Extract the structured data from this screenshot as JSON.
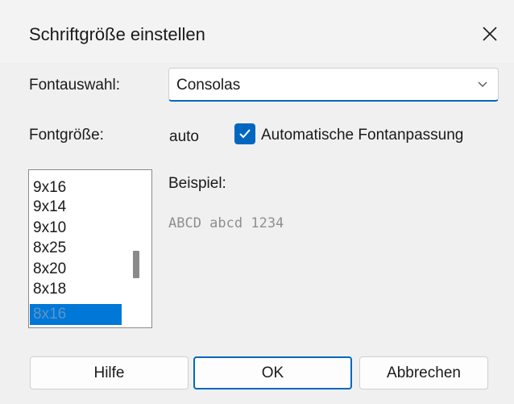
{
  "dialog": {
    "title": "Schriftgröße einstellen"
  },
  "font_select": {
    "label": "Fontauswahl:",
    "value": "Consolas"
  },
  "font_size": {
    "label": "Fontgröße:",
    "value": "auto",
    "auto_fit_label": "Automatische Fontanpassung",
    "auto_fit_checked": true
  },
  "size_list": {
    "items": [
      "9x16",
      "9x14",
      "9x10",
      "8x25",
      "8x20",
      "8x18",
      "8x16"
    ],
    "selected": "8x16"
  },
  "preview": {
    "label": "Beispiel:",
    "sample_text": "ABCD abcd 1234"
  },
  "buttons": {
    "help": "Hilfe",
    "ok": "OK",
    "cancel": "Abbrechen"
  },
  "colors": {
    "accent": "#0067c0",
    "selection": "#0078d7",
    "background": "#f0f0f0"
  },
  "icons": {
    "close": "close-icon",
    "dropdown": "chevron-down-icon",
    "check": "checkmark-icon"
  }
}
